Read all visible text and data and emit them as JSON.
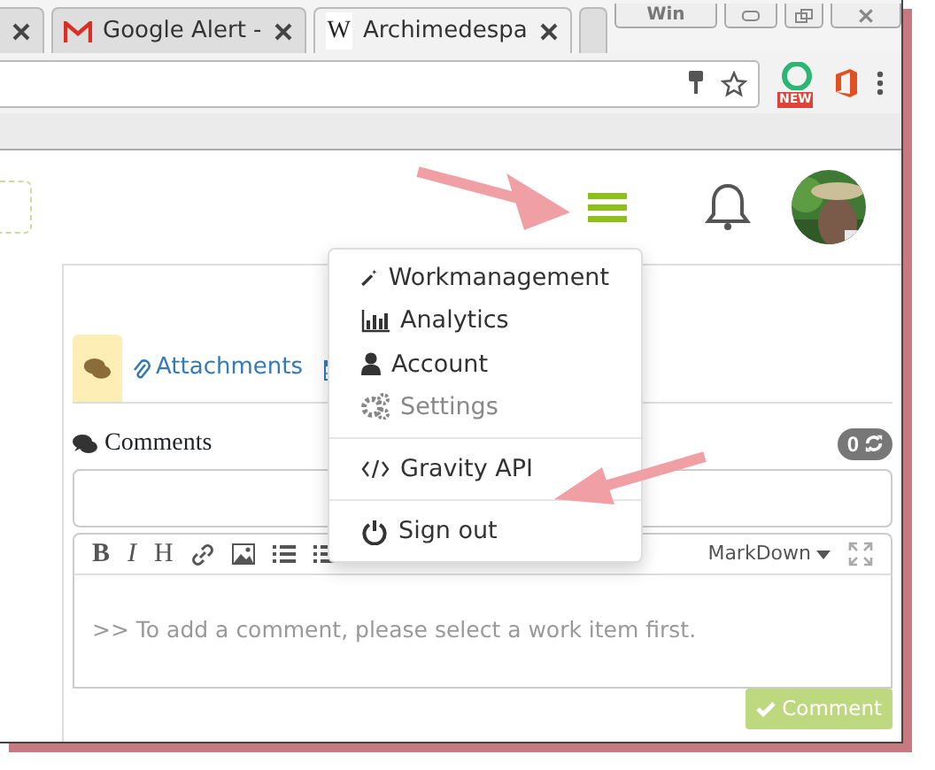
{
  "browser": {
    "tabs": [
      {
        "selected": false
      },
      {
        "title": "Google Alert -",
        "selected": false
      },
      {
        "title": "Archimedespa",
        "favicon_text": "W",
        "selected": true
      }
    ],
    "win_label": "Win",
    "extension_badge": "NEW"
  },
  "comments_tabs": [
    {
      "selected": true
    },
    {
      "label": "Attachments",
      "selected": false
    },
    {
      "selected": false
    }
  ],
  "comments": {
    "title": "Comments",
    "count": "0",
    "toolbar": [
      {
        "kind": "text",
        "label": "B"
      },
      {
        "kind": "text",
        "label": "I"
      },
      {
        "kind": "text",
        "label": "H"
      },
      {
        "kind": "icon"
      },
      {
        "kind": "icon"
      },
      {
        "kind": "icon"
      },
      {
        "kind": "icon"
      }
    ],
    "mode": "MarkDown",
    "placeholder": ">> To add a comment, please select a work item first.",
    "submit": {
      "label": "Comment",
      "disabled": true
    }
  },
  "menu": [
    {
      "kind": "item",
      "label": "Workmanagement",
      "disabled": false
    },
    {
      "kind": "item",
      "label": "Analytics",
      "disabled": false
    },
    {
      "kind": "item",
      "label": "Account",
      "disabled": false
    },
    {
      "kind": "item",
      "label": "Settings",
      "disabled": true
    },
    {
      "kind": "divider"
    },
    {
      "kind": "item",
      "label": "Gravity API",
      "disabled": false
    },
    {
      "kind": "divider"
    },
    {
      "kind": "item",
      "label": "Sign out",
      "disabled": false
    }
  ]
}
